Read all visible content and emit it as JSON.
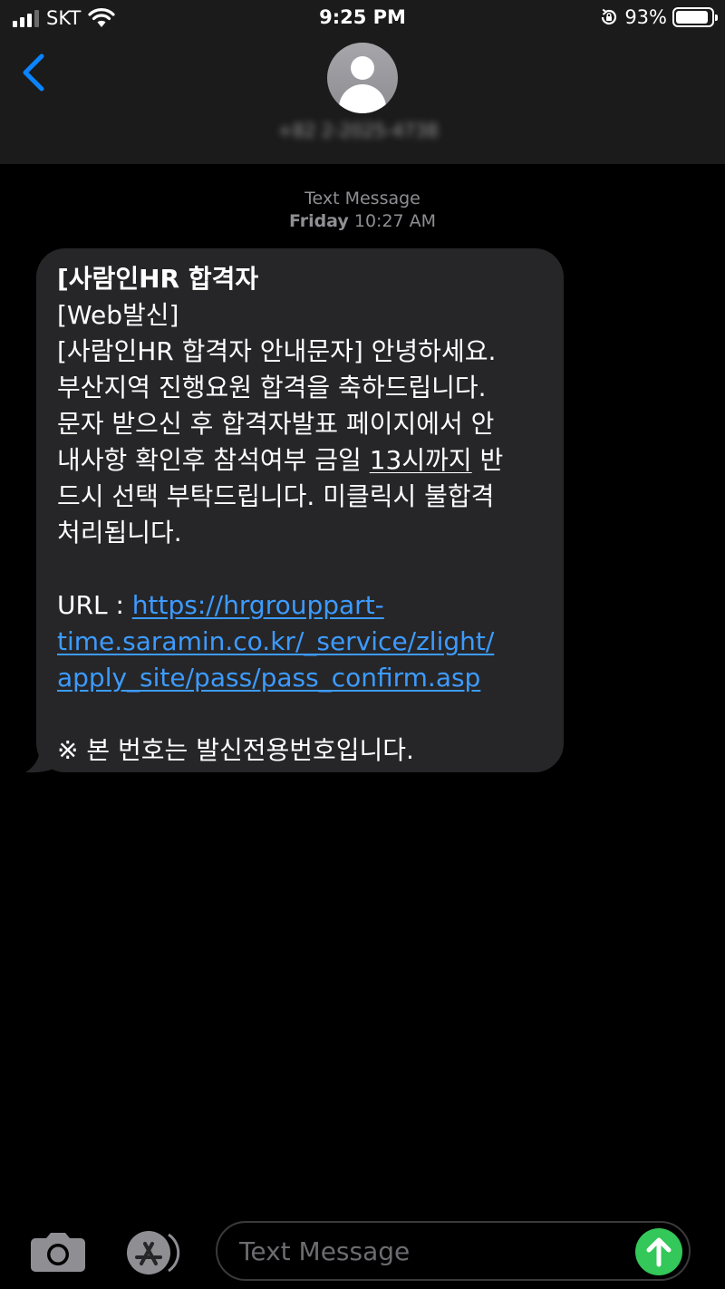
{
  "status_bar": {
    "carrier": "SKT",
    "time": "9:25 PM",
    "battery_percent": "93%",
    "battery_level": 0.93,
    "signal_bars": 3,
    "icons": [
      "signal-icon",
      "wifi-icon",
      "rotation-lock-icon",
      "battery-icon"
    ]
  },
  "header": {
    "contact_name": "+82 2-2025-4738",
    "icons": [
      "chevron-left-icon",
      "person-icon"
    ]
  },
  "conversation": {
    "timestamp_label": "Text Message",
    "timestamp_day": "Friday",
    "timestamp_time": "10:27 AM",
    "message": {
      "title": "[사람인HR 합격자",
      "lines": [
        "[Web발신]",
        "[사람인HR 합격자 안내문자] 안녕하세요.",
        "부산지역 진행요원 합격을 축하드립니다.",
        "문자 받으신 후 합격자발표 페이지에서 안"
      ],
      "line5_before": "내사항 확인후 참석여부 금일 ",
      "line5_underlined": "13시까지",
      "line5_after": " 반",
      "lines2": [
        "드시 선택 부탁드립니다. 미클릭시 불합격",
        "처리됩니다."
      ],
      "url_label": "URL : ",
      "url_lines": [
        "https://hrgrouppart-",
        "time.saramin.co.kr/_service/zlight/",
        "apply_site/pass/pass_confirm.asp"
      ],
      "notice": "※ 본 번호는 발신전용번호입니다."
    }
  },
  "input_bar": {
    "placeholder": "Text Message",
    "accent_color": "#34c759",
    "icons": [
      "camera-icon",
      "app-store-icon",
      "arrow-up-icon"
    ]
  },
  "colors": {
    "background": "#000000",
    "bar": "#1b1b1b",
    "bubble": "#262628",
    "link": "#3d9bff",
    "accent_blue": "#0a84ff"
  }
}
